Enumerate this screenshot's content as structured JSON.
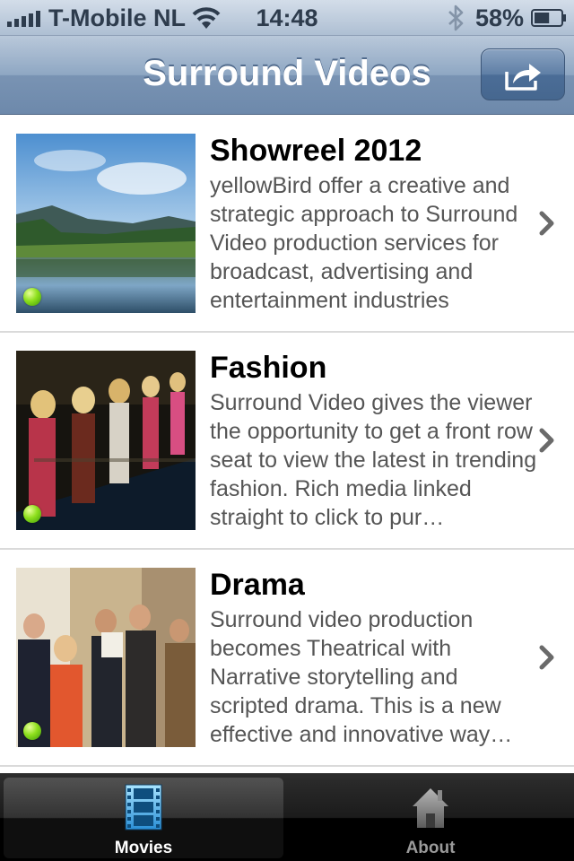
{
  "status_bar": {
    "carrier": "T-Mobile NL",
    "time": "14:48",
    "battery_percent": "58%",
    "battery_level": 0.58,
    "icons": [
      "signal-icon",
      "wifi-icon",
      "bluetooth-icon",
      "battery-icon"
    ]
  },
  "nav": {
    "title": "Surround Videos",
    "share_icon": "share-icon"
  },
  "items": [
    {
      "title": "Showreel 2012",
      "description": "yellowBird offer a creative and strategic approach to Surround Video production services for broadcast, advertising and entertainment industries",
      "thumbnail": "lake-landscape",
      "status": "available"
    },
    {
      "title": "Fashion",
      "description": "Surround Video gives the viewer the opportunity to get a front row seat to view the latest in trending fashion. Rich media linked straight to click to pur…",
      "thumbnail": "fashion-runway",
      "status": "available"
    },
    {
      "title": "Drama",
      "description": "Surround video production becomes Theatrical with Narrative storytelling and scripted drama. This is a new effective and innovative way…",
      "thumbnail": "group-photo",
      "status": "available"
    }
  ],
  "tabs": [
    {
      "label": "Movies",
      "icon": "film-icon",
      "selected": true
    },
    {
      "label": "About",
      "icon": "house-icon",
      "selected": false
    }
  ],
  "colors": {
    "nav_bar": "#7993b3",
    "status_dot": "#8ee01d",
    "tab_bar": "#000000"
  }
}
